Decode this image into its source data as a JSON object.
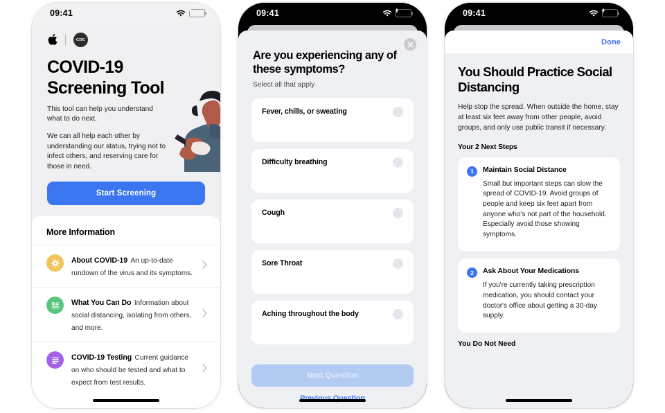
{
  "statusbar": {
    "time": "09:41",
    "wifi_icon": "wifi-icon",
    "battery_icon": "battery-charging-icon"
  },
  "screen1": {
    "name": "covid-19-screening-tool-landing",
    "logos": {
      "apple": "apple-logo",
      "cdc_text": "CDC"
    },
    "title": "COVID-19 Screening Tool",
    "paragraphs": [
      "This tool can help you understand what to do next.",
      "We can all help each other by understanding our status, trying not to infect others, and reserving care for those in need."
    ],
    "cta_label": "Start Screening",
    "more_info_heading": "More Information",
    "info_items": [
      {
        "icon": "virus-icon",
        "icon_color": "#f0c45a",
        "title": "About COVID-19",
        "desc": "An up-to-date rundown of the virus and its symptoms."
      },
      {
        "icon": "checklist-icon",
        "icon_color": "#5bc47f",
        "title": "What You Can Do",
        "desc": "Information about social distancing, isolating from others, and more."
      },
      {
        "icon": "document-lines-icon",
        "icon_color": "#a263e8",
        "title": "COVID-19 Testing",
        "desc": "Current guidance on who should be tested and what to expect from test results."
      }
    ]
  },
  "screen2": {
    "name": "symptoms-question-sheet",
    "close_icon": "close-icon",
    "title": "Are you experiencing any of these symptoms?",
    "subtitle": "Select all that apply",
    "symptoms": [
      "Fever, chills, or sweating",
      "Difficulty breathing",
      "Cough",
      "Sore Throat",
      "Aching throughout the body"
    ],
    "next_label": "Next Question",
    "prev_label": "Previous Question"
  },
  "screen3": {
    "name": "social-distancing-result-sheet",
    "done_label": "Done",
    "title": "You Should Practice Social Distancing",
    "intro": "Help stop the spread. When outside the home, stay at least six feet away from other people, avoid groups, and only use public transit if necessary.",
    "steps_heading": "Your 2 Next Steps",
    "steps": [
      {
        "number": "1",
        "title": "Maintain Social Distance",
        "desc": "Small but important steps can slow the spread of COVID-19. Avoid groups of people and keep six feet apart from anyone who's not part of the household. Especially avoid those showing symptoms."
      },
      {
        "number": "2",
        "title": "Ask About Your Medications",
        "desc": "If you're currently taking prescription medication, you should contact your doctor's office about getting a 30-day supply."
      }
    ],
    "not_need_heading": "You Do Not Need"
  },
  "colors": {
    "accent_blue": "#3b76f0",
    "disabled_blue": "#b2cbf3",
    "sheet_bg": "#eef0f3",
    "battery_green": "#34c759"
  }
}
